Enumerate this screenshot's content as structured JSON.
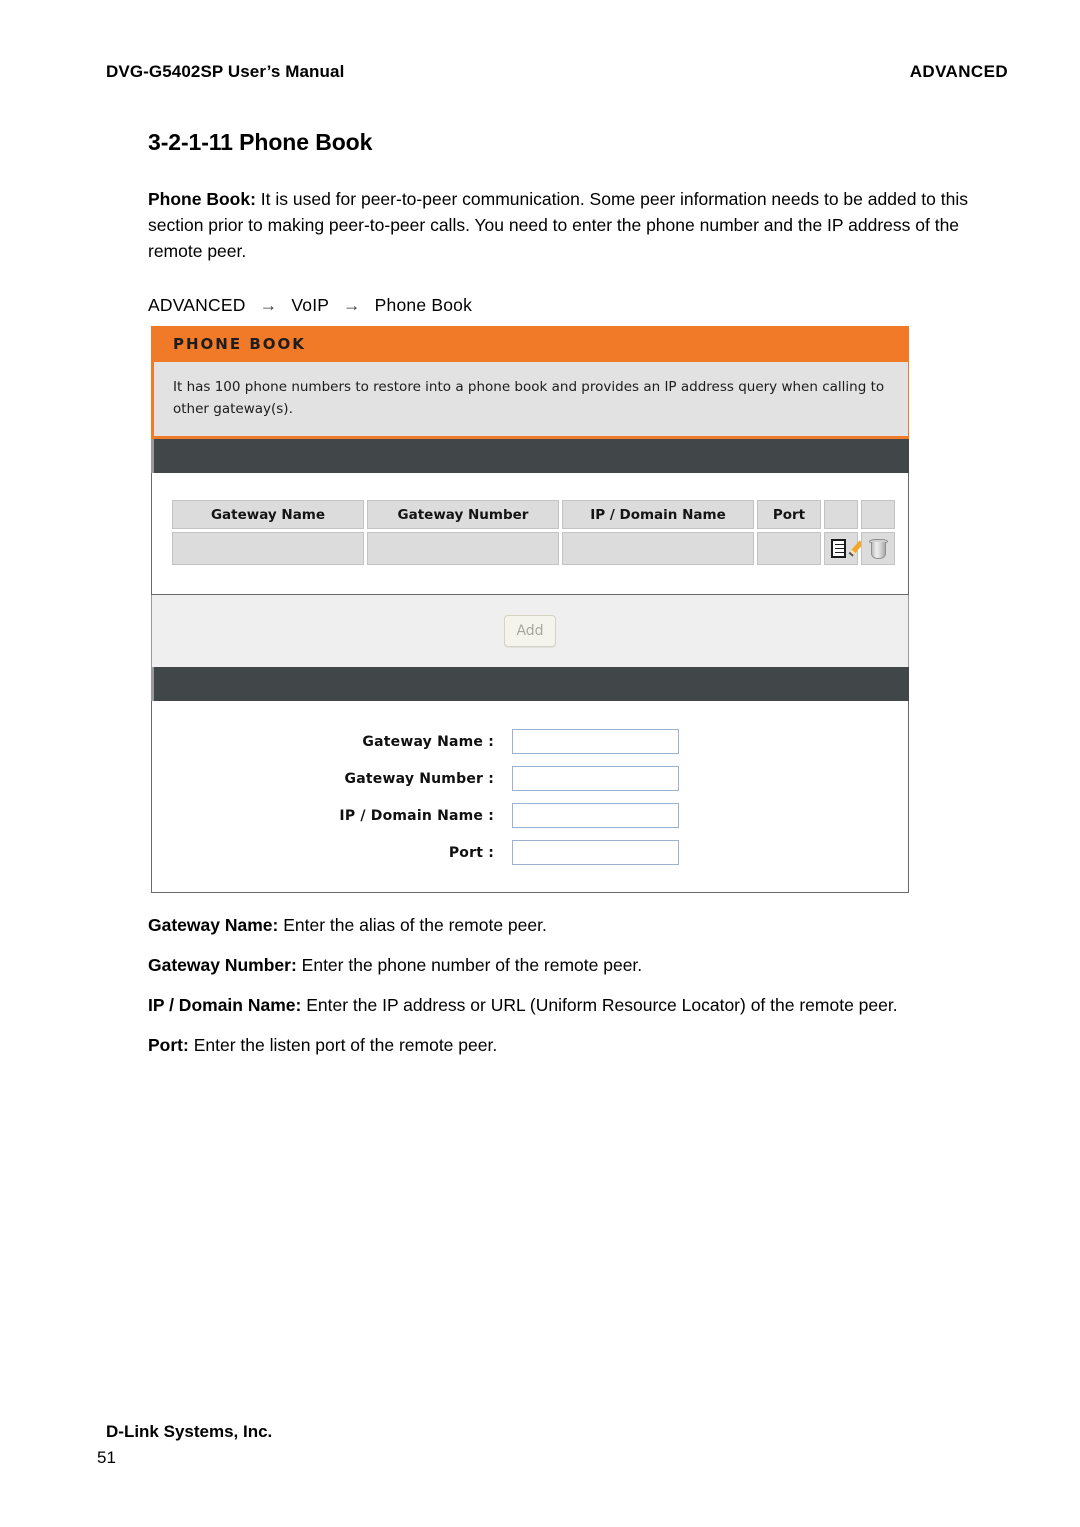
{
  "running_head": {
    "left": "DVG-G5402SP User’s Manual",
    "right": "ADVANCED"
  },
  "section": {
    "heading": "3-2-1-11 Phone Book"
  },
  "intro": {
    "label": "Phone Book:",
    "text": " It is used for peer-to-peer communication. Some peer information needs to be added to this section prior to making peer-to-peer calls. You need to enter the phone number and the IP address of the remote peer."
  },
  "breadcrumb": {
    "item1": "ADVANCED",
    "sep1": "→",
    "item2": "VoIP",
    "sep2": "→",
    "item3": "Phone Book"
  },
  "panel": {
    "title": "PHONE BOOK",
    "description": "It has 100 phone numbers to restore into a phone book and provides an IP address query when calling to other gateway(s).",
    "table": {
      "headers": [
        "Gateway Name",
        "Gateway Number",
        "IP / Domain Name",
        "Port",
        "",
        ""
      ],
      "rows": [
        {
          "gateway_name": "",
          "gateway_number": "",
          "ip_domain_name": "",
          "port": "",
          "edit_icon": "edit-icon",
          "delete_icon": "trash-icon"
        }
      ]
    },
    "add_button_label": "Add",
    "form": {
      "fields": [
        {
          "label": "Gateway Name :",
          "value": ""
        },
        {
          "label": "Gateway Number :",
          "value": ""
        },
        {
          "label": "IP / Domain Name :",
          "value": ""
        },
        {
          "label": "Port :",
          "value": ""
        }
      ]
    },
    "colors": {
      "header_orange": "#F07A28",
      "dark_bar": "#414749",
      "description_bg": "#E2E2E2",
      "cell_gray": "#DCDCDC",
      "add_band": "#EFEFEF",
      "input_border": "#9BB3D0"
    }
  },
  "descriptions": [
    {
      "term": "Gateway Name:",
      "text": " Enter the alias of the remote peer."
    },
    {
      "term": "Gateway Number:",
      "text": " Enter the phone number of the remote peer."
    },
    {
      "term": "IP / Domain Name:",
      "text": " Enter the IP address or URL (Uniform Resource Locator) of the remote peer."
    },
    {
      "term": "Port:",
      "text": " Enter the listen port of the remote peer."
    }
  ],
  "footer": {
    "company": "D-Link Systems, Inc.",
    "page_number": "51"
  }
}
